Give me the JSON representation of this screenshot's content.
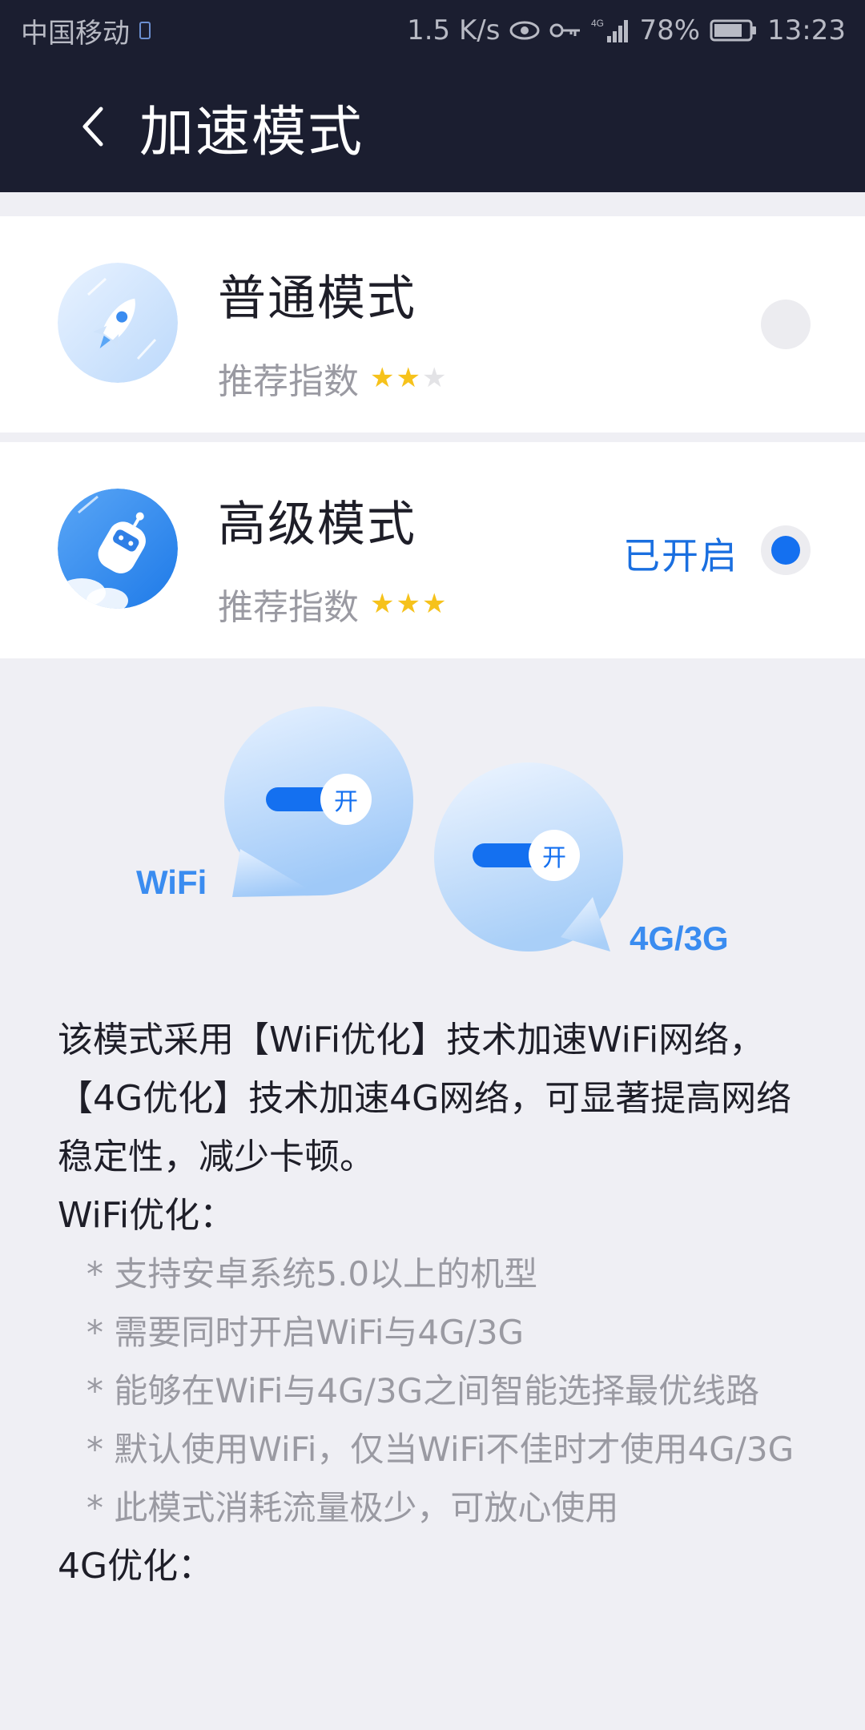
{
  "status_bar": {
    "carrier": "中国移动",
    "speed": "1.5 K/s",
    "network": "4G",
    "battery": "78%",
    "time": "13:23"
  },
  "header": {
    "title": "加速模式",
    "back_icon": "chevron-left-icon"
  },
  "modes": [
    {
      "name": "普通模式",
      "rating_label": "推荐指数",
      "stars": 2,
      "max_stars": 3,
      "icon": "rocket-icon",
      "selected": false,
      "status": ""
    },
    {
      "name": "高级模式",
      "rating_label": "推荐指数",
      "stars": 3,
      "max_stars": 3,
      "icon": "robot-rocket-icon",
      "selected": true,
      "status": "已开启"
    }
  ],
  "illustration": {
    "wifi_label": "WiFi",
    "cellular_label": "4G/3G",
    "toggle_text": "开"
  },
  "description": {
    "intro": "该模式采用【WiFi优化】技术加速WiFi网络，【4G优化】技术加速4G网络，可显著提高网络稳定性，减少卡顿。",
    "wifi_heading": "WiFi优化：",
    "wifi_points": [
      "* 支持安卓系统5.0以上的机型",
      "* 需要同时开启WiFi与4G/3G",
      "* 能够在WiFi与4G/3G之间智能选择最优线路",
      "* 默认使用WiFi，仅当WiFi不佳时才使用4G/3G",
      "* 此模式消耗流量极少，可放心使用"
    ],
    "cellular_heading": "4G优化："
  },
  "colors": {
    "header_bg": "#1b1e30",
    "accent_blue": "#1470f0",
    "star_yellow": "#f6c21b",
    "page_bg": "#efeff4"
  }
}
